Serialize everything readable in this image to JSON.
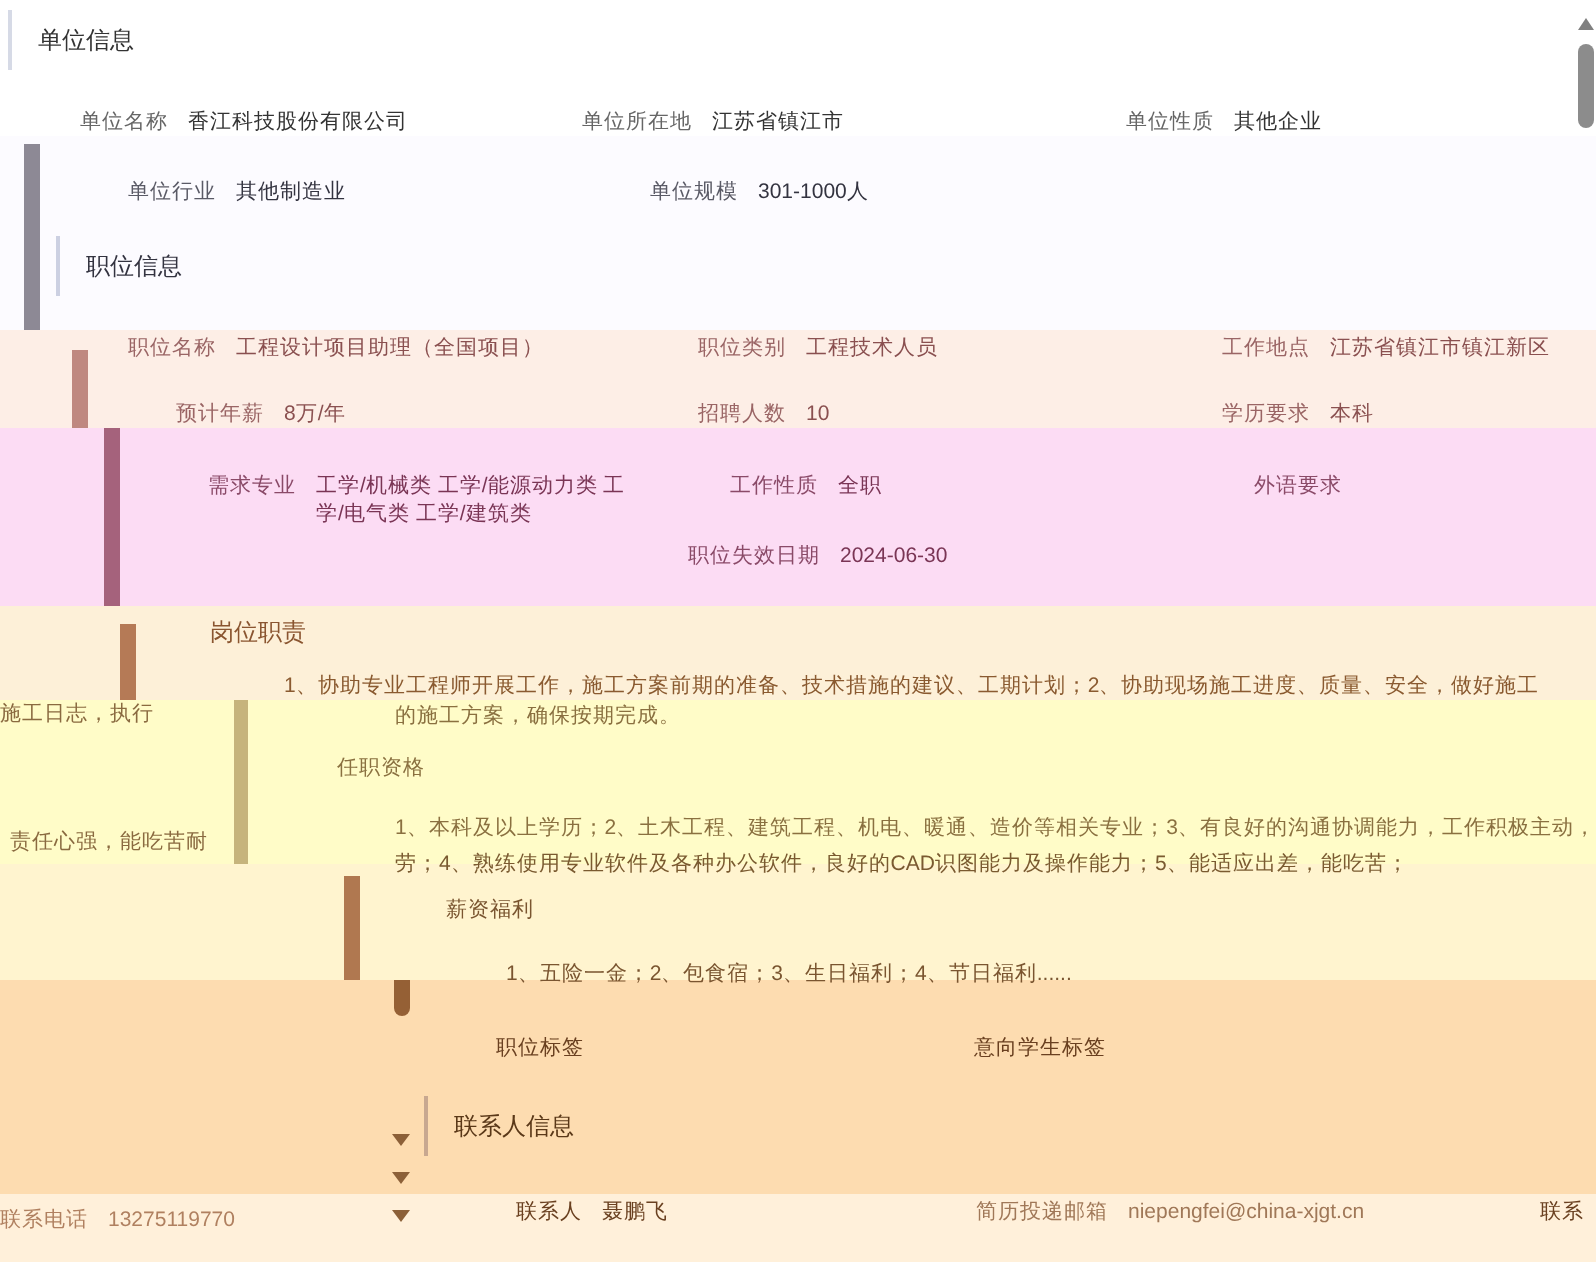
{
  "company_info": {
    "title": "单位信息",
    "fields": [
      {
        "label": "单位名称",
        "value": "香江科技股份有限公司"
      },
      {
        "label": "单位所在地",
        "value": "江苏省镇江市"
      },
      {
        "label": "单位性质",
        "value": "其他企业"
      },
      {
        "label": "单位行业",
        "value": "其他制造业"
      },
      {
        "label": "单位规模",
        "value": "301-1000人"
      }
    ]
  },
  "position_info": {
    "title": "职位信息",
    "fields": [
      {
        "label": "职位名称",
        "value": "工程设计项目助理（全国项目）"
      },
      {
        "label": "职位类别",
        "value": "工程技术人员"
      },
      {
        "label": "工作地点",
        "value": "江苏省镇江市镇江新区"
      },
      {
        "label": "预计年薪",
        "value": "8万/年"
      },
      {
        "label": "招聘人数",
        "value": "10"
      },
      {
        "label": "学历要求",
        "value": "本科"
      },
      {
        "label": "需求专业",
        "value": "工学/机械类 工学/能源动力类 工学/电气类 工学/建筑类"
      },
      {
        "label": "工作性质",
        "value": "全职"
      },
      {
        "label": "外语要求"
      },
      {
        "label": "职位失效日期",
        "value": "2024-06-30"
      }
    ]
  },
  "duties": {
    "title": "岗位职责",
    "lines": [
      "1、协助专业工程师开展工作，施工方案前期的准备、技术措施的建议、工期计划；2、协助现场施工进度、质量、安全，做好施工",
      "施工日志，执行",
      "的施工方案，确保按期完成。"
    ]
  },
  "qualifications": {
    "title": "任职资格",
    "lines": [
      "1、本科及以上学历；2、土木工程、建筑工程、机电、暖通、造价等相关专业；3、有良好的沟通协调能力，工作积极主动，",
      "责任心强，能吃苦耐",
      "劳；4、熟练使用专业软件及各种办公软件，良好的CAD识图能力及操作能力；5、能适应出差，能吃苦；"
    ]
  },
  "benefits": {
    "title": "薪资福利",
    "text": "1、五险一金；2、包食宿；3、生日福利；4、节日福利......"
  },
  "tags": [
    {
      "label": "职位标签"
    },
    {
      "label": "意向学生标签"
    }
  ],
  "contact_info": {
    "title": "联系人信息",
    "fields": [
      {
        "label": "联系电话",
        "value": "13275119770"
      },
      {
        "label": "联系人",
        "value": "聂鹏飞"
      },
      {
        "label": "简历投递邮箱",
        "value": "niepengfei@china-xjgt.cn"
      },
      {
        "label": "联系"
      }
    ]
  }
}
